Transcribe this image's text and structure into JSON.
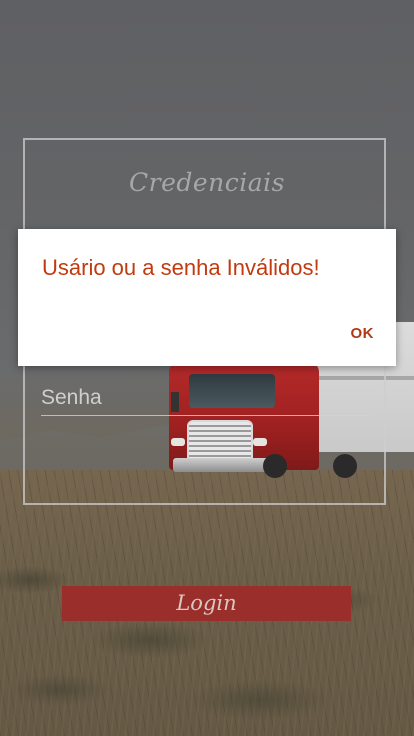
{
  "card": {
    "title": "Credenciais",
    "password_placeholder": "Senha"
  },
  "login": {
    "label": "Login"
  },
  "dialog": {
    "message": "Usário ou a senha Inválidos!",
    "ok_label": "OK"
  },
  "colors": {
    "accent": "#9a2e2a",
    "dialog_text": "#c23a10"
  }
}
